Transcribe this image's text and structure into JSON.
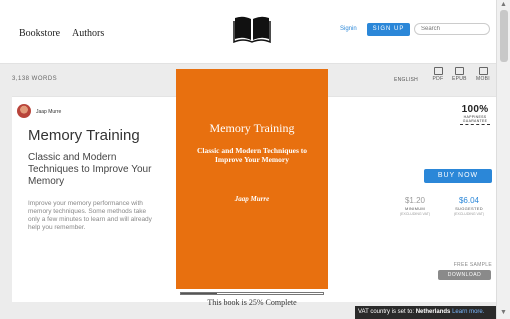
{
  "header": {
    "nav": [
      "Bookstore",
      "Authors"
    ],
    "signin": "Signin",
    "signup": "SIGN UP",
    "search_placeholder": "Search"
  },
  "stats": {
    "words": "3,138 WORDS",
    "language": "ENGLISH",
    "formats": [
      "PDF",
      "EPUB",
      "MOBI"
    ]
  },
  "book": {
    "author": "Jaap Murre",
    "title": "Memory Training",
    "subtitle": "Classic and Modern Techniques to Improve Your Memory",
    "description": "Improve your memory performance with memory techniques. Some methods take only a few minutes to learn and will already help you remember."
  },
  "cover": {
    "title": "Memory Training",
    "subtitle": "Classic and Modern Techniques to Improve Your Memory",
    "author": "Jaap Murre"
  },
  "progress": {
    "percent": 25,
    "label": "This book is 25% Complete"
  },
  "badge": {
    "main": "100%",
    "sub": "HAPPINESS GUARANTEE"
  },
  "purchase": {
    "buy_label": "BUY NOW",
    "minimum": {
      "price": "$1.20",
      "label": "MINIMUM",
      "note": "(EXCLUDING VAT)"
    },
    "suggested": {
      "price": "$6.04",
      "label": "SUGGESTED",
      "note": "(EXCLUDING VAT)"
    },
    "free_label": "FREE SAMPLE",
    "download_label": "DOWNLOAD"
  },
  "vat": {
    "prefix": "VAT country is set to: ",
    "country": "Netherlands",
    "link": "Learn more."
  },
  "colors": {
    "accent": "#2b87d8",
    "cover": "#e8700f",
    "suggested_price": "#2b87d8",
    "minimum_price": "#9a9a9a"
  }
}
